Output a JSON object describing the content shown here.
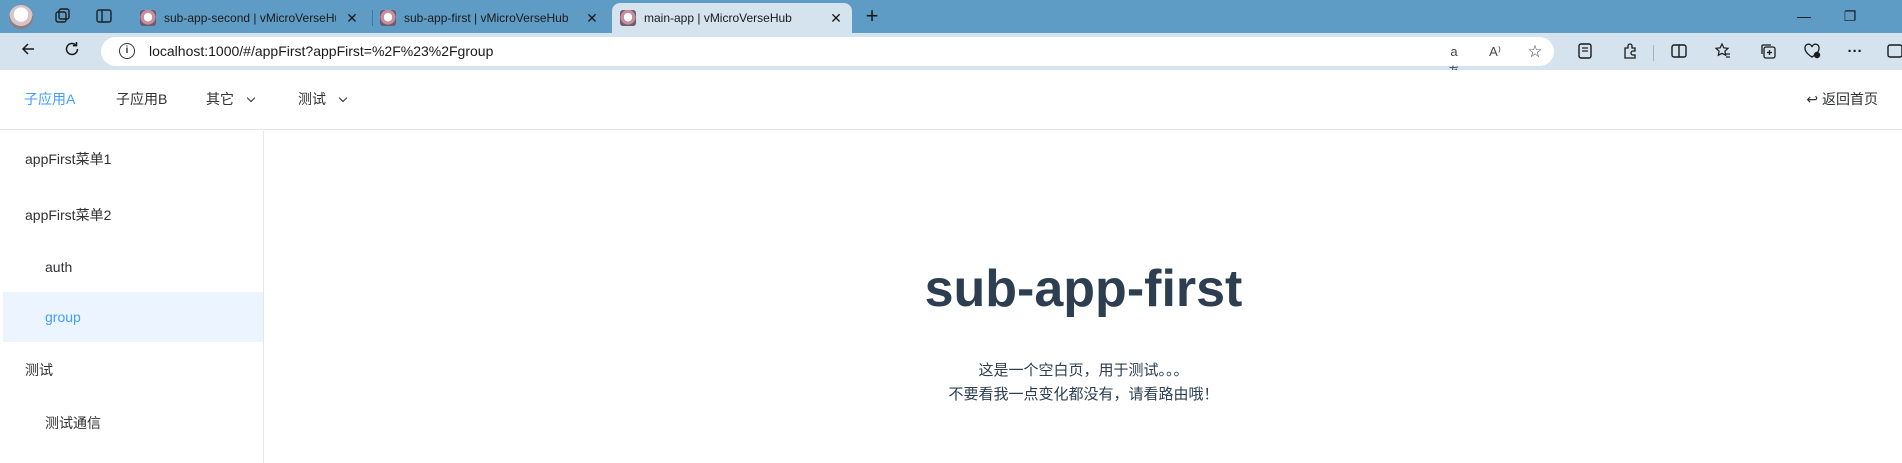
{
  "browser": {
    "tabs": [
      {
        "title": "sub-app-second | vMicroVerseHub",
        "active": false
      },
      {
        "title": "sub-app-first | vMicroVerseHub",
        "active": false
      },
      {
        "title": "main-app | vMicroVerseHub",
        "active": true
      }
    ],
    "close_glyph": "✕",
    "new_tab_glyph": "+",
    "window_controls": {
      "minimize": "—",
      "restore": "❐"
    },
    "url": "localhost:1000/#/appFirst?appFirst=%2F%23%2Fgroup",
    "url_icons": {
      "translate": "aあ",
      "read_aloud": "A⁾",
      "favorite": "☆"
    },
    "toolbar_icons": {
      "more": "···"
    }
  },
  "app": {
    "header": {
      "menu": [
        {
          "label": "子应用A",
          "active": true
        },
        {
          "label": "子应用B",
          "active": false
        },
        {
          "label": "其它",
          "has_dropdown": true
        },
        {
          "label": "测试",
          "has_dropdown": true
        }
      ],
      "back_home": "↩ 返回首页"
    },
    "sidebar": {
      "items": [
        {
          "label": "appFirst菜单1",
          "level": 1
        },
        {
          "label": "appFirst菜单2",
          "level": 1
        },
        {
          "label": "auth",
          "level": 2
        },
        {
          "label": "group",
          "level": 2,
          "active": true
        },
        {
          "label": "测试",
          "level": 1
        },
        {
          "label": "测试通信",
          "level": 2
        }
      ]
    },
    "main": {
      "title": "sub-app-first",
      "desc_line1": "这是一个空白页，用于测试。。。",
      "desc_line2": "不要看我一点变化都没有，请看路由哦！"
    },
    "colors": {
      "accent": "#409eff",
      "active_bg": "#ecf5ff",
      "title": "#2c3e50",
      "tabstrip": "#5f9cc5",
      "toolbar": "#d4e3ee"
    }
  }
}
